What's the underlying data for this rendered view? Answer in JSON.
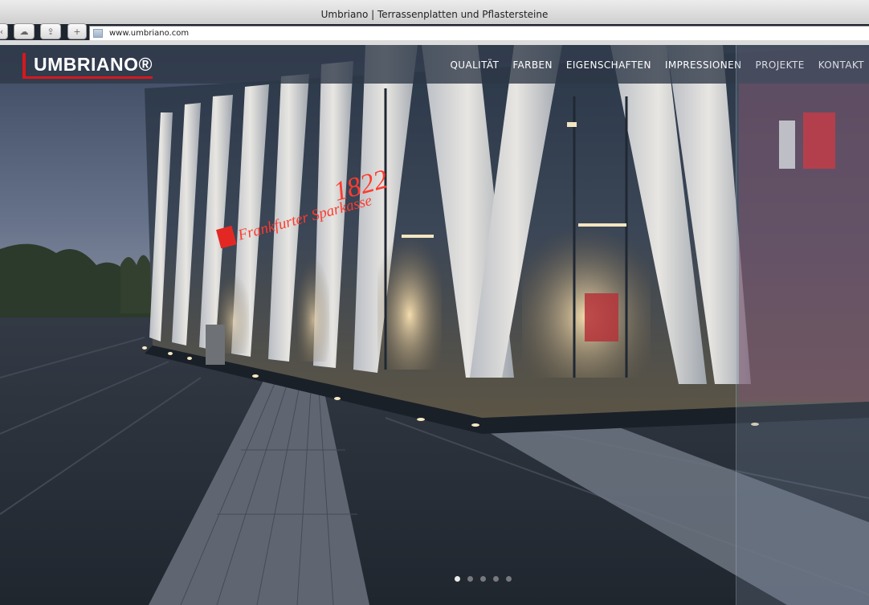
{
  "browser": {
    "window_title": "Umbriano | Terrassenplatten und Pflastersteine",
    "url": "www.umbriano.com"
  },
  "site": {
    "brand": "UMBRIANO®",
    "brand_color": "#d8171c",
    "nav": [
      "QUALITÄT",
      "FARBEN",
      "EIGENSCHAFTEN",
      "IMPRESSIONEN",
      "PROJEKTE",
      "KONTAKT"
    ]
  },
  "hero": {
    "sign_text": "Frankfurter Sparkasse",
    "sign_year": "1822"
  },
  "slider": {
    "total": 5,
    "active": 1
  }
}
